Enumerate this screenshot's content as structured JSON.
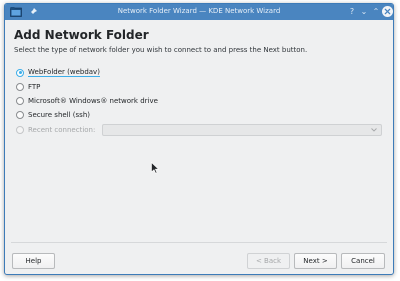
{
  "window": {
    "title": "Network Folder Wizard — KDE Network Wizard",
    "help_glyph": "?",
    "minimize_glyph": "⌄",
    "maximize_glyph": "⌃"
  },
  "page": {
    "heading": "Add Network Folder",
    "instruction": "Select the type of network folder you wish to connect to and press the Next button."
  },
  "options": [
    {
      "label": "WebFolder (webdav)",
      "checked": true,
      "enabled": true
    },
    {
      "label": "FTP",
      "checked": false,
      "enabled": true
    },
    {
      "label": "Microsoft® Windows® network drive",
      "checked": false,
      "enabled": true
    },
    {
      "label": "Secure shell (ssh)",
      "checked": false,
      "enabled": true
    },
    {
      "label": "Recent connection:",
      "checked": false,
      "enabled": false
    }
  ],
  "recent_combo": {
    "value": ""
  },
  "buttons": {
    "help": "Help",
    "back": "< Back",
    "next": "Next >",
    "cancel": "Cancel"
  },
  "colors": {
    "titlebar": "#4a85c0",
    "accent": "#3daee9",
    "window_bg": "#eff0f1"
  }
}
